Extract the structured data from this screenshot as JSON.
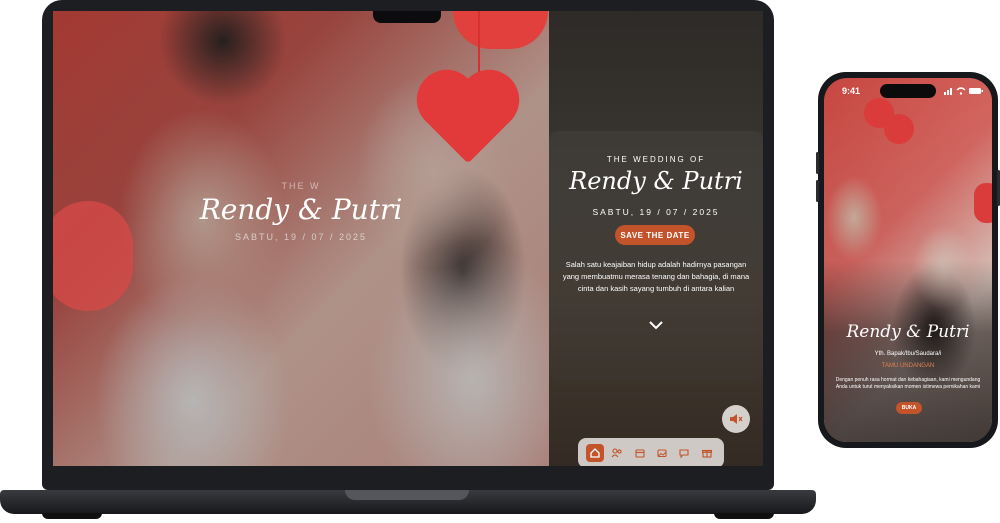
{
  "laptop": {
    "left_panel": {
      "eyebrow": "THE W",
      "title": "Rendy & Putri",
      "date": "SABTU, 19 / 07 / 2025"
    },
    "right_panel": {
      "eyebrow": "THE WEDDING OF",
      "title": "Rendy & Putri",
      "date": "SABTU, 19 / 07 / 2025",
      "save_button": "SAVE THE DATE",
      "body": "Salah satu keajaiban hidup adalah hadirnya pasangan yang membuatmu merasa tenang dan bahagia, di mana cinta dan kasih sayang tumbuh di antara kalian",
      "scroll_icon": "chevron-down-icon",
      "mute_icon": "speaker-mute-icon",
      "nav_items": [
        "home-icon",
        "couple-icon",
        "calendar-icon",
        "gallery-icon",
        "message-icon",
        "gift-icon"
      ]
    }
  },
  "phone": {
    "status_time": "9:41",
    "title": "Rendy & Putri",
    "guest_salutation": "Yth. Bapak/Ibu/Saudara/i",
    "guest_label": "TAMU UNDANGAN",
    "body": "Dengan penuh rasa hormat dan kebahagiaan, kami mengundang Anda untuk turut menyaksikan momen istimewa pernikahan kami",
    "open_button": "BUKA"
  },
  "colors": {
    "accent": "#c2532a",
    "heart": "#e23a3a",
    "device_frame": "#1d1e22"
  }
}
